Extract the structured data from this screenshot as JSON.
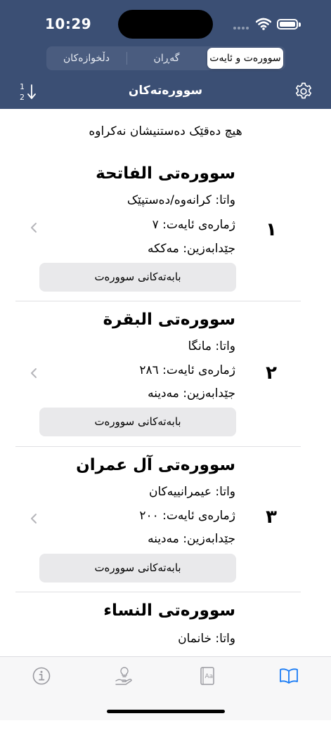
{
  "status": {
    "time": "10:29"
  },
  "segments": [
    {
      "label": "سوورەت و ئایەت",
      "active": true
    },
    {
      "label": "گەڕان",
      "active": false
    },
    {
      "label": "دڵخوازەکان",
      "active": false
    }
  ],
  "nav": {
    "title": "سوورەتەکان",
    "sort_icon_text": {
      "num": "1",
      "den": "2"
    }
  },
  "notice": "هیچ دەقێک دەستنیشان نەکراوە",
  "surahs": [
    {
      "number": "١",
      "title": "سوورەتی الفاتحة",
      "meaning": "واتا: کرانەوە/دەستپێک",
      "ayah_count": "ژمارەی ئایەت: ٧",
      "revelation": "جێدابەزین: مەککە",
      "button": "بابەتەکانی سوورەت"
    },
    {
      "number": "٢",
      "title": "سوورەتی البقرة",
      "meaning": "واتا: مانگا",
      "ayah_count": "ژمارەی ئایەت: ٢٨٦",
      "revelation": "جێدابەزین: مەدینە",
      "button": "بابەتەکانی سوورەت"
    },
    {
      "number": "٣",
      "title": "سوورەتی آل عمران",
      "meaning": "واتا: عیمرانییەکان",
      "ayah_count": "ژمارەی ئایەت: ٢٠٠",
      "revelation": "جێدابەزین: مەدینە",
      "button": "بابەتەکانی سوورەت"
    },
    {
      "number": "",
      "title": "سوورەتی النساء",
      "meaning": "واتا: خانمان",
      "ayah_count": "",
      "revelation": "",
      "button": ""
    }
  ],
  "tabbar": [
    {
      "icon": "info-icon",
      "selected": false
    },
    {
      "icon": "hand-lightbulb-icon",
      "selected": false
    },
    {
      "icon": "dictionary-icon",
      "selected": false
    },
    {
      "icon": "open-book-icon",
      "selected": true
    }
  ],
  "colors": {
    "header_bg": "#3b4f74",
    "accent": "#1a7cf5",
    "button_bg": "#e9e9eb"
  }
}
